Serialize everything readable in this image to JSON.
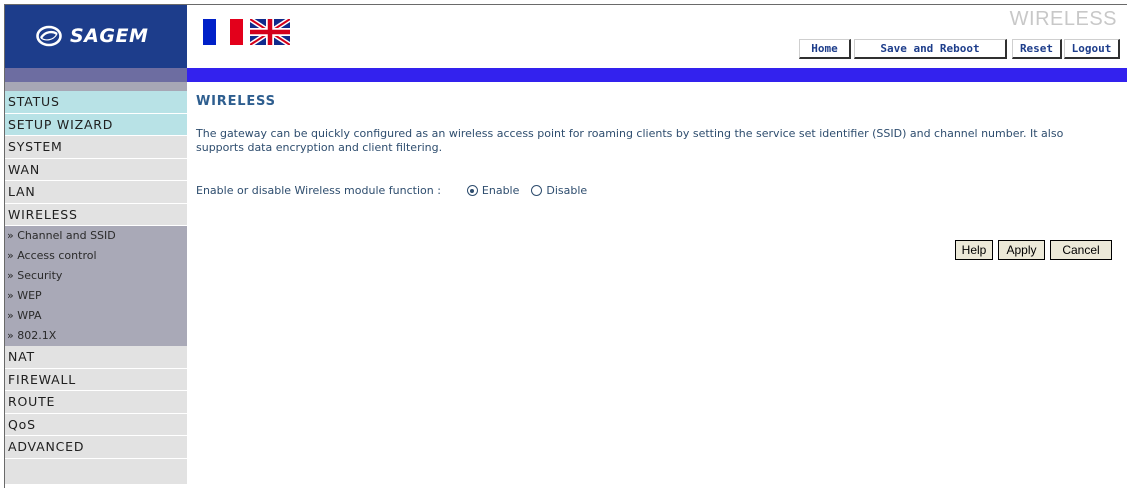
{
  "header": {
    "logo_text": "SAGEM",
    "page_title": "WIRELESS",
    "flags": [
      "french-flag-icon",
      "uk-flag-icon"
    ],
    "brand_color": "#1d3d8b",
    "bar_color": "#3322ee"
  },
  "topnav": {
    "home": "Home",
    "save_reboot": "Save and Reboot",
    "reset": "Reset",
    "logout": "Logout"
  },
  "sidebar": {
    "status": "STATUS",
    "setup_wizard": "SETUP WIZARD",
    "system": "SYSTEM",
    "wan": "WAN",
    "lan": "LAN",
    "wireless": "WIRELESS",
    "sub": [
      "» Channel and SSID",
      "» Access control",
      "» Security",
      "» WEP",
      "» WPA",
      "» 802.1X"
    ],
    "nat": "NAT",
    "firewall": "FIREWALL",
    "route": "ROUTE",
    "qos": "QoS",
    "advanced": "ADVANCED"
  },
  "main": {
    "heading": "WIRELESS",
    "description": "The gateway can be quickly configured as an wireless access point for roaming clients by setting the service set identifier (SSID) and channel number. It also supports data encryption and client filtering.",
    "enable_label": "Enable or disable Wireless module function :",
    "enable_option": "Enable",
    "disable_option": "Disable",
    "selected": "Enable"
  },
  "actions": {
    "help": "Help",
    "apply": "Apply",
    "cancel": "Cancel"
  }
}
